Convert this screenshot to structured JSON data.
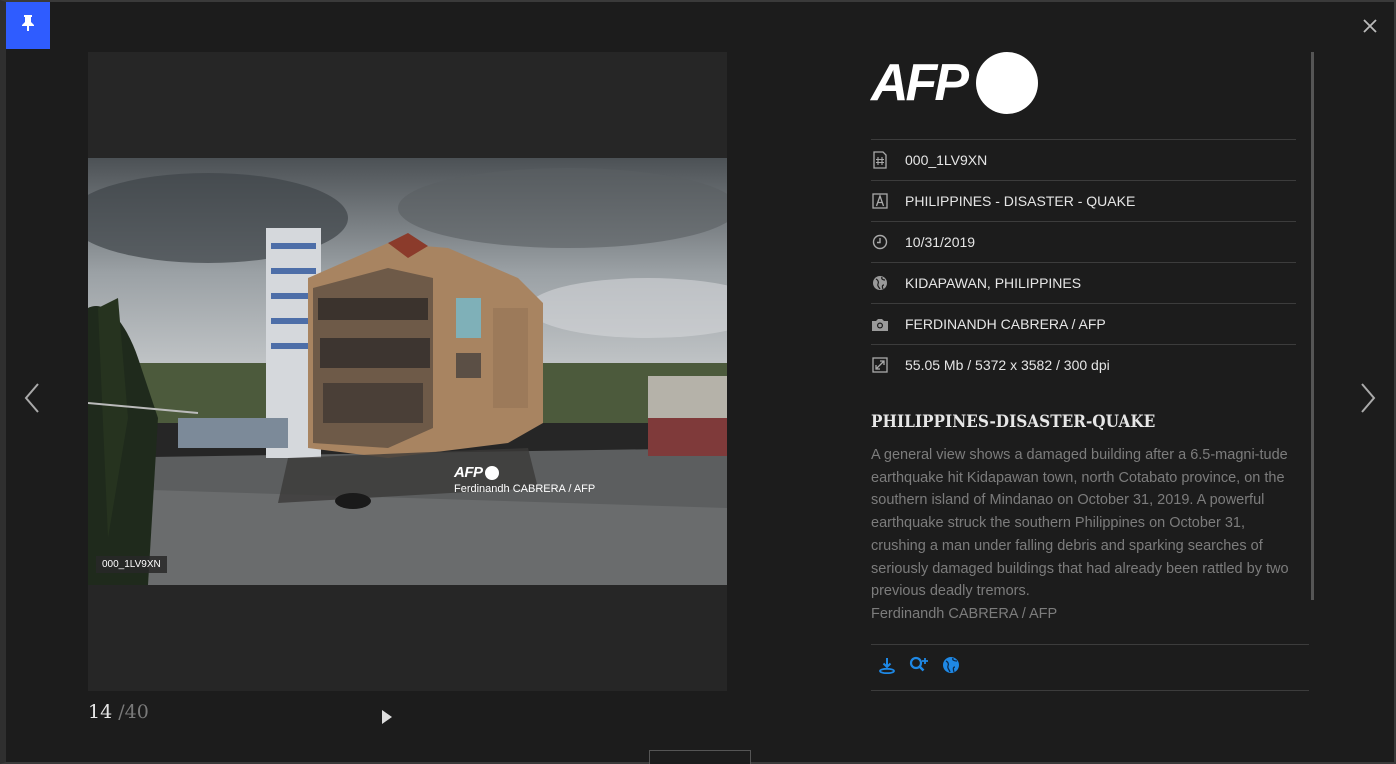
{
  "viewer": {
    "counter_current": "14",
    "counter_total": "/40",
    "image_id_tag": "000_1LV9XN",
    "watermark_logo": "AFP",
    "watermark_credit": "Ferdinandh CABRERA / AFP"
  },
  "brand": {
    "logo_text": "AFP"
  },
  "metadata": [
    {
      "icon": "hash-document-icon",
      "value": "000_1LV9XN"
    },
    {
      "icon": "letter-a-icon",
      "value": "PHILIPPINES - DISASTER - QUAKE"
    },
    {
      "icon": "clock-icon",
      "value": "10/31/2019"
    },
    {
      "icon": "globe-icon",
      "value": "KIDAPAWAN, PHILIPPINES"
    },
    {
      "icon": "camera-icon",
      "value": "FERDINANDH CABRERA / AFP"
    },
    {
      "icon": "resize-icon",
      "value": "55.05 Mb / 5372 x 3582 / 300 dpi"
    }
  ],
  "story": {
    "headline": "PHILIPPINES-DISASTER-QUAKE",
    "caption": "A general view shows a damaged building after a 6.5-magni-tude earthquake hit Kidapawan town, north Cotabato province, on the southern island of Mindanao on October 31, 2019. A powerful earthquake struck the southern Philippines on October 31, crushing a man under falling debris and sparking searches of seriously damaged buildings that had already been rattled by two previous deadly tremors.",
    "credit": "Ferdinandh CABRERA / AFP"
  },
  "actions": [
    "download-icon",
    "zoom-in-icon",
    "globe-icon"
  ],
  "colors": {
    "accent": "#2f5cff",
    "action_icons": "#1e88e5",
    "background": "#1c1c1c",
    "viewer_bg": "#262626"
  }
}
